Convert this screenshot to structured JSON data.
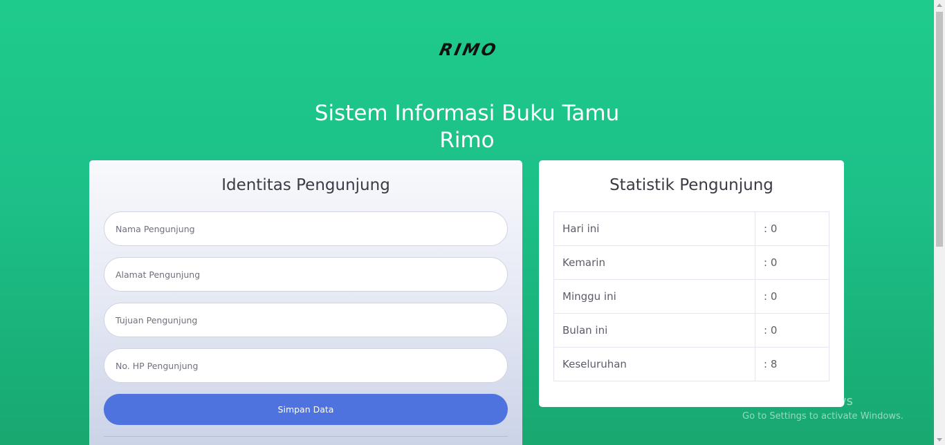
{
  "brand": {
    "logo_text": "RIMO",
    "logo_icon": "rimo-logo"
  },
  "header": {
    "title_line1": "Sistem Informasi Buku Tamu",
    "title_line2": "Rimo"
  },
  "form": {
    "title": "Identitas Pengunjung",
    "fields": [
      {
        "placeholder": "Nama Pengunjung",
        "value": ""
      },
      {
        "placeholder": "Alamat Pengunjung",
        "value": ""
      },
      {
        "placeholder": "Tujuan Pengunjung",
        "value": ""
      },
      {
        "placeholder": "No. HP Pengunjung",
        "value": ""
      }
    ],
    "submit_label": "Simpan Data"
  },
  "stats": {
    "title": "Statistik Pengunjung",
    "rows": [
      {
        "label": "Hari ini",
        "value": ": 0"
      },
      {
        "label": "Kemarin",
        "value": ": 0"
      },
      {
        "label": "Minggu ini",
        "value": ": 0"
      },
      {
        "label": "Bulan ini",
        "value": ": 0"
      },
      {
        "label": "Keseluruhan",
        "value": ": 8"
      }
    ]
  },
  "overlay": {
    "activate_title": "Activate Windows",
    "activate_sub": "Go to Settings to activate Windows."
  },
  "colors": {
    "accent": "#4e73df",
    "background": "#1cc88a"
  }
}
